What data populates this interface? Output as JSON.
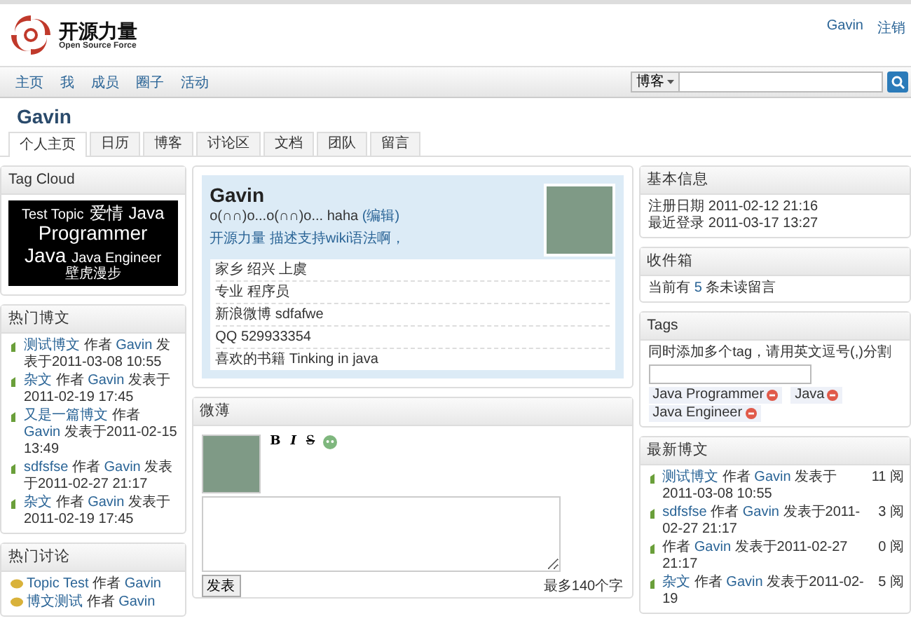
{
  "header": {
    "logo_title": "开源力量",
    "logo_subtitle": "Open Source Force",
    "user_links": [
      "Gavin",
      "注销"
    ]
  },
  "nav": {
    "items": [
      "主页",
      "我",
      "成员",
      "圈子",
      "活动"
    ],
    "search": {
      "scope": "博客"
    }
  },
  "page_title": "Gavin",
  "tabs": [
    {
      "label": "个人主页",
      "selected": true
    },
    {
      "label": "日历",
      "selected": false
    },
    {
      "label": "博客",
      "selected": false
    },
    {
      "label": "讨论区",
      "selected": false
    },
    {
      "label": "文档",
      "selected": false
    },
    {
      "label": "团队",
      "selected": false
    },
    {
      "label": "留言",
      "selected": false
    }
  ],
  "tag_cloud": {
    "title": "Tag Cloud",
    "tags": [
      {
        "label": "Test Topic",
        "kind": "small"
      },
      {
        "label": "爱情",
        "kind": "medium"
      },
      {
        "label": "Java",
        "kind": "medium"
      },
      {
        "label": "Programmer",
        "kind": "large"
      },
      {
        "label": "Java",
        "kind": "large"
      },
      {
        "label": "Java Engineer",
        "kind": "small"
      },
      {
        "label": "壁虎漫步",
        "kind": "small"
      }
    ]
  },
  "hot_blogs": {
    "title": "热门博文",
    "items": [
      {
        "title": "测试博文",
        "by": "作者",
        "author": "Gavin",
        "posted": "发表于2011-03-08 10:55"
      },
      {
        "title": "杂文",
        "by": "作者",
        "author": "Gavin",
        "posted": "发表于2011-02-19 17:45"
      },
      {
        "title": "又是一篇博文",
        "by": "作者",
        "author": "Gavin",
        "posted": "发表于2011-02-15 13:49"
      },
      {
        "title": "sdfsfse",
        "by": "作者",
        "author": "Gavin",
        "posted": "发表于2011-02-27 21:17"
      },
      {
        "title": "杂文",
        "by": "作者",
        "author": "Gavin",
        "posted": "发表于2011-02-19 17:45"
      }
    ]
  },
  "hot_discussions": {
    "title": "热门讨论",
    "items": [
      {
        "title": "Topic Test",
        "by": "作者",
        "author": "Gavin"
      },
      {
        "title": "博文测试",
        "by": "作者",
        "author": "Gavin"
      }
    ]
  },
  "profile": {
    "name": "Gavin",
    "status": "o(∩∩)o...o(∩∩)o... haha",
    "edit_link": "(编辑)",
    "description": "开源力量 描述支持wiki语法啊，",
    "fields": [
      {
        "label": "家乡",
        "value": "绍兴 上虞"
      },
      {
        "label": "专业",
        "value": "程序员"
      },
      {
        "label": "新浪微博",
        "value": "sdfafwe"
      },
      {
        "label": "QQ",
        "value": "529933354"
      },
      {
        "label": "喜欢的书籍",
        "value": "Tinking in java"
      }
    ]
  },
  "microblog": {
    "title": "微薄",
    "toolbar": [
      "B",
      "I",
      "S"
    ],
    "submit": "发表",
    "limit": "最多140个字"
  },
  "basic_info": {
    "title": "基本信息",
    "rows": [
      {
        "label": "注册日期",
        "value": "2011-02-12 21:16"
      },
      {
        "label": "最近登录",
        "value": "2011-03-17 13:27"
      }
    ]
  },
  "inbox": {
    "title": "收件箱",
    "prefix": "当前有",
    "count": "5",
    "suffix": "条未读留言"
  },
  "tags": {
    "title": "Tags",
    "hint": "同时添加多个tag，请用英文逗号(,)分割",
    "items": [
      "Java Programmer",
      "Java",
      "Java Engineer"
    ]
  },
  "latest_blogs": {
    "title": "最新博文",
    "items": [
      {
        "title": "测试博文",
        "by": "作者",
        "author": "Gavin",
        "posted": "发表于2011-03-08 10:55",
        "reads": "11 阅"
      },
      {
        "title": "sdfsfse",
        "by": "作者",
        "author": "Gavin",
        "posted": "发表于2011-02-27 21:17",
        "reads": "3 阅"
      },
      {
        "by": "作者",
        "author": "Gavin",
        "posted": "发表于2011-02-27 21:17",
        "reads": "0 阅"
      },
      {
        "title": "杂文",
        "by": "作者",
        "author": "Gavin",
        "posted": "发表于2011-02-19",
        "reads": "5 阅"
      }
    ]
  }
}
